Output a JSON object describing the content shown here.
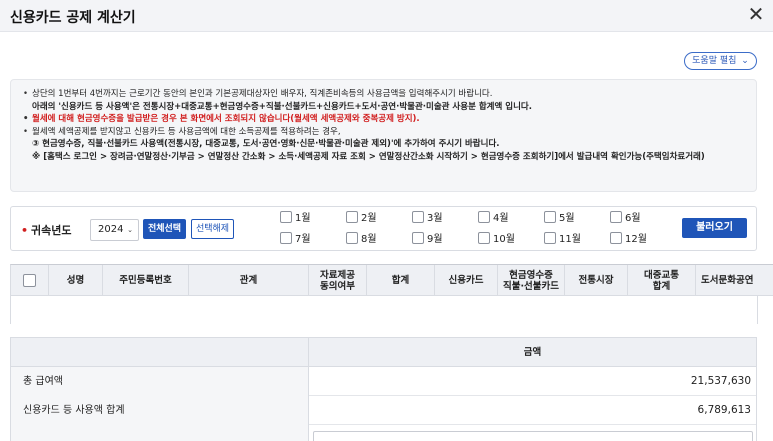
{
  "window": {
    "title": "신용카드 공제 계산기",
    "close_glyph": "✕",
    "close_icon": "close-icon"
  },
  "help_button": {
    "label": "도움말 펼침",
    "chevron": "⌄",
    "icon": "chevron-down-icon"
  },
  "notice": {
    "line1": "상단의 1번부터 4번까지는 근로기간 동안의 본인과 기본공제대상자인 배우자, 직계존비속등의 사용금액을 입력해주시기 바랍니다.",
    "line2": "아래의 '신용카드 등 사용액'은 전통시장+대중교통+현금영수증+직불·선불카드+신용카드+도서·공연·박물관·미술관 사용분 합계액 입니다.",
    "line3": "월세에 대해 현금영수증을 발급받은 경우 본 화면에서 조회되지 않습니다(월세액 세액공제와 중복공제 방지).",
    "line4": "월세액 세액공제를 받지않고 신용카드 등 사용금액에 대한 소득공제를 적용하려는 경우,",
    "line5": "③ 현금영수증, 직불·선불카드 사용액(전통시장, 대중교통, 도서·공연·영화·신문·박물관·미술관 제외)'에 추가하여 주시기 바랍니다.",
    "line6": "※ [홈택스 로그인 > 장려금·연말정산·기부금 > 연말정산 간소화 > 소득·세액공제 자료 조회 > 연말정산간소화 시작하기 > 현금영수증 조회하기]에서 발급내역 확인가능(주택임차료거래)",
    "bullet": "•"
  },
  "year_filter": {
    "required_mark": "•",
    "label": "귀속년도",
    "year_value": "2024",
    "select_caret": "⌄",
    "select_all_label": "전체선택",
    "clear_label": "선택해제",
    "months": [
      "1월",
      "2월",
      "3월",
      "4월",
      "5월",
      "6월",
      "7월",
      "8월",
      "9월",
      "10월",
      "11월",
      "12월"
    ],
    "load_label": "불러오기"
  },
  "grid": {
    "columns": [
      "",
      "성명",
      "주민등록번호",
      "관계",
      "자료제공\n동의여부",
      "합계",
      "신용카드",
      "현금영수증\n직불·선불카드",
      "전통시장",
      "대중교통\n합계",
      "도서문화공연"
    ],
    "rows": []
  },
  "summary": {
    "header": "금액",
    "rows": [
      {
        "label": "총 급여액",
        "value": "21,537,630"
      },
      {
        "label": "신용카드 등 사용액 합계",
        "value": "6,789,613"
      }
    ]
  },
  "colors": {
    "primary": "#1f55b8",
    "required": "#d11f1f",
    "header_bg": "#eef0f4",
    "panel_bg": "#f5f6f8"
  }
}
